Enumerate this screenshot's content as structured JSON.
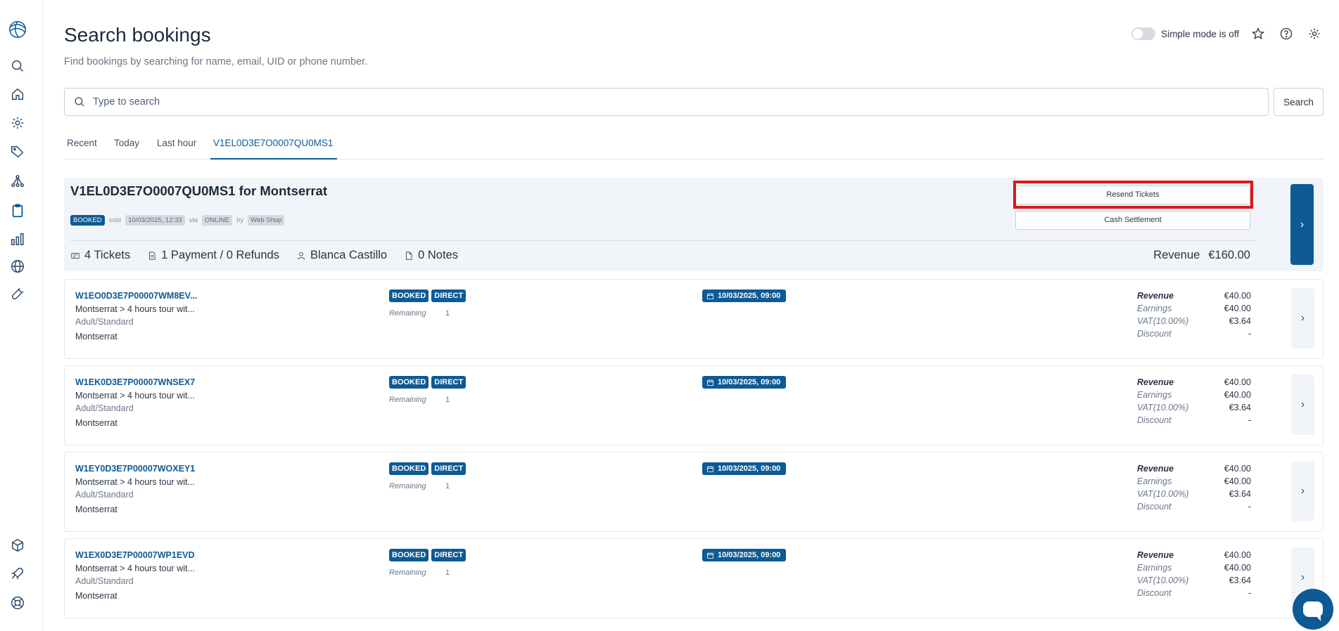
{
  "header": {
    "title": "Search bookings",
    "subtitle": "Find bookings by searching for name, email, UID or phone number.",
    "simple_mode": "Simple mode is off"
  },
  "search": {
    "placeholder": "Type to search",
    "button": "Search"
  },
  "tabs": [
    {
      "label": "Recent"
    },
    {
      "label": "Today"
    },
    {
      "label": "Last hour"
    },
    {
      "label": "V1EL0D3E7O0007QU0MS1",
      "active": true
    }
  ],
  "booking": {
    "title": "V1EL0D3E7O0007QU0MS1 for Montserrat",
    "status": "BOOKED",
    "sold_label": "sold",
    "sold_date": "10/03/2025, 12:33",
    "via_label": "via",
    "channel": "ONLINE",
    "by_label": "by",
    "seller": "Web Shop",
    "resend_button": "Resend Tickets",
    "cash_button": "Cash Settlement",
    "tickets": "4 Tickets",
    "payments": "1 Payment / 0 Refunds",
    "customer": "Blanca Castillo",
    "notes": "0 Notes",
    "revenue_label": "Revenue",
    "revenue_value": "€160.00"
  },
  "ticket_labels": {
    "remaining": "Remaining",
    "revenue": "Revenue",
    "earnings": "Earnings",
    "vat": "VAT(10.00%)",
    "discount": "Discount"
  },
  "tickets": [
    {
      "id": "W1EO0D3E7P00007WM8EV...",
      "tour": "Montserrat > 4 hours tour wit...",
      "type": "Adult/Standard",
      "location": "Montserrat",
      "status": "BOOKED",
      "channel": "DIRECT",
      "remaining": "1",
      "date": "10/03/2025, 09:00",
      "revenue": "€40.00",
      "earnings": "€40.00",
      "vat": "€3.64",
      "discount": "-"
    },
    {
      "id": "W1EK0D3E7P00007WNSEX7",
      "tour": "Montserrat > 4 hours tour wit...",
      "type": "Adult/Standard",
      "location": "Montserrat",
      "status": "BOOKED",
      "channel": "DIRECT",
      "remaining": "1",
      "date": "10/03/2025, 09:00",
      "revenue": "€40.00",
      "earnings": "€40.00",
      "vat": "€3.64",
      "discount": "-"
    },
    {
      "id": "W1EY0D3E7P00007WOXEY1",
      "tour": "Montserrat > 4 hours tour wit...",
      "type": "Adult/Standard",
      "location": "Montserrat",
      "status": "BOOKED",
      "channel": "DIRECT",
      "remaining": "1",
      "date": "10/03/2025, 09:00",
      "revenue": "€40.00",
      "earnings": "€40.00",
      "vat": "€3.64",
      "discount": "-"
    },
    {
      "id": "W1EX0D3E7P00007WP1EVD",
      "tour": "Montserrat > 4 hours tour wit...",
      "type": "Adult/Standard",
      "location": "Montserrat",
      "status": "BOOKED",
      "channel": "DIRECT",
      "remaining": "1",
      "date": "10/03/2025, 09:00",
      "revenue": "€40.00",
      "earnings": "€40.00",
      "vat": "€3.64",
      "discount": "-"
    }
  ],
  "colors": {
    "accent": "#0d5a94",
    "highlight": "#e0161b",
    "card_bg": "#f1f4f8"
  },
  "icons": {
    "sidebar_top": [
      "search-icon",
      "home-icon",
      "gear-icon",
      "tag-icon",
      "network-icon",
      "clipboard-icon",
      "bar-chart-icon",
      "globe-icon",
      "wrench-icon"
    ],
    "sidebar_bottom": [
      "cube-icon",
      "rocket-icon",
      "lifebuoy-icon"
    ]
  }
}
